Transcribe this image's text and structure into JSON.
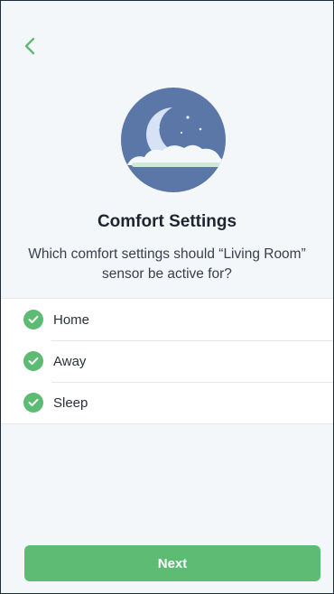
{
  "header": {
    "back_icon": "chevron-left-icon"
  },
  "hero": {
    "icon": "moon-night-icon"
  },
  "title": "Comfort Settings",
  "subtitle": "Which comfort settings should “Living Room” sensor be active for?",
  "options": [
    {
      "label": "Home",
      "checked": true
    },
    {
      "label": "Away",
      "checked": true
    },
    {
      "label": "Sleep",
      "checked": true
    }
  ],
  "next_label": "Next",
  "colors": {
    "accent": "#5dbb73",
    "background": "#f4f7fa",
    "hero_circle": "#5a77a8"
  }
}
